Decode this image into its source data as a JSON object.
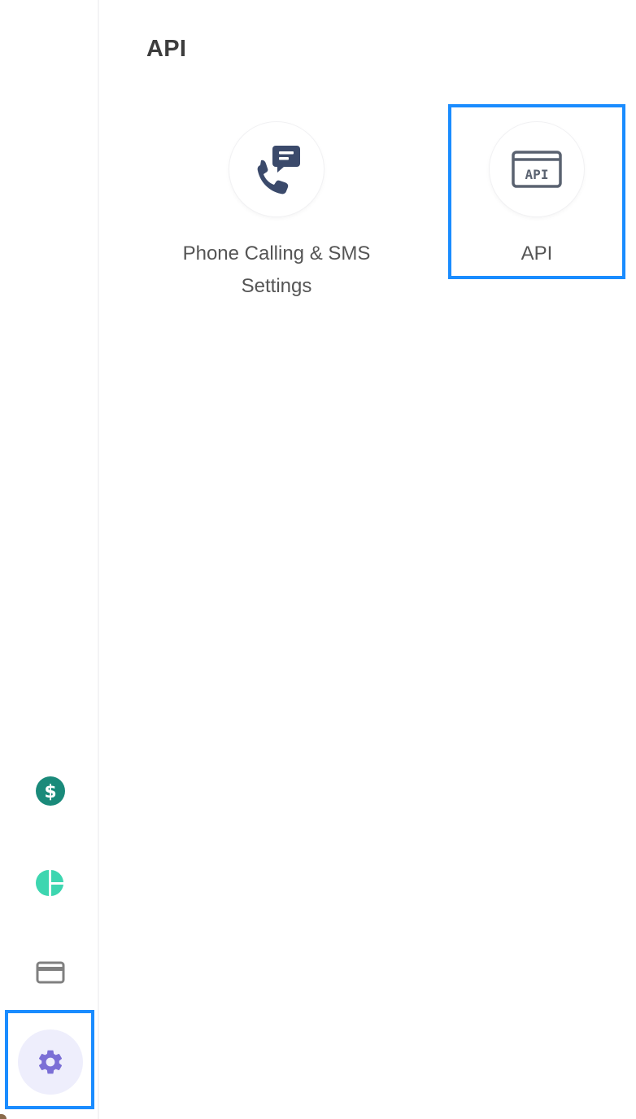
{
  "main": {
    "title": "API",
    "tiles": [
      {
        "label": "Phone Calling & SMS Settings",
        "icon": "phone-message-icon"
      },
      {
        "label": "API",
        "icon": "api-icon"
      }
    ]
  },
  "sidebar": {
    "items": [
      {
        "icon": "dollar-icon",
        "color": "#1a8a7a"
      },
      {
        "icon": "pie-chart-icon",
        "color": "#3dd6b0"
      },
      {
        "icon": "credit-card-icon",
        "color": "#808080"
      },
      {
        "icon": "gear-icon",
        "color": "#7b6fd6",
        "active": true
      }
    ]
  },
  "colors": {
    "highlight": "#1a8cff",
    "icon_dark": "#3b4a6b",
    "text": "#555555"
  }
}
